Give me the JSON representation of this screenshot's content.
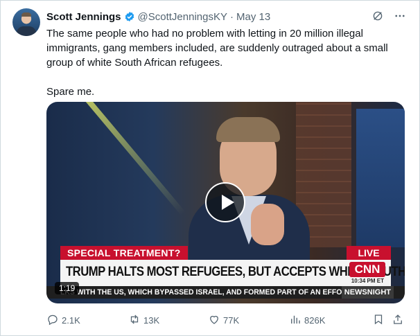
{
  "author": {
    "name": "Scott Jennings",
    "handle": "@ScottJenningsKY",
    "separator": "·",
    "date": "May 13"
  },
  "tweet": {
    "paragraphs": [
      "The same people who had no problem with letting in 20 million illegal immigrants, gang members included, are suddenly outraged about a small group of white South African refugees.",
      "Spare me."
    ]
  },
  "media": {
    "tag": "SPECIAL TREATMENT?",
    "live": "LIVE",
    "headline": "TRUMP HALTS MOST REFUGEES, BUT ACCEPTS WHITE SOUTH AFRICANS",
    "network_logo": "CNN",
    "network_time": "10:34 PM ET",
    "ticker": "LKS WITH THE US, WHICH BYPASSED ISRAEL, AND FORMED PART OF AN EFFORT",
    "ticker_brand": "NEWSNIGHT",
    "duration": "1:19"
  },
  "actions": {
    "replies": "2.1K",
    "reposts": "13K",
    "likes": "77K",
    "views": "826K"
  },
  "icons": {
    "verified": "verified-badge-icon",
    "grok": "grok-icon",
    "more": "more-icon",
    "reply": "reply-icon",
    "repost": "repost-icon",
    "like": "like-icon",
    "views": "views-icon",
    "bookmark": "bookmark-icon",
    "share": "share-icon"
  },
  "colors": {
    "verified": "#1d9bf0",
    "secondary_text": "#536471",
    "cnn_red": "#c8102e"
  }
}
